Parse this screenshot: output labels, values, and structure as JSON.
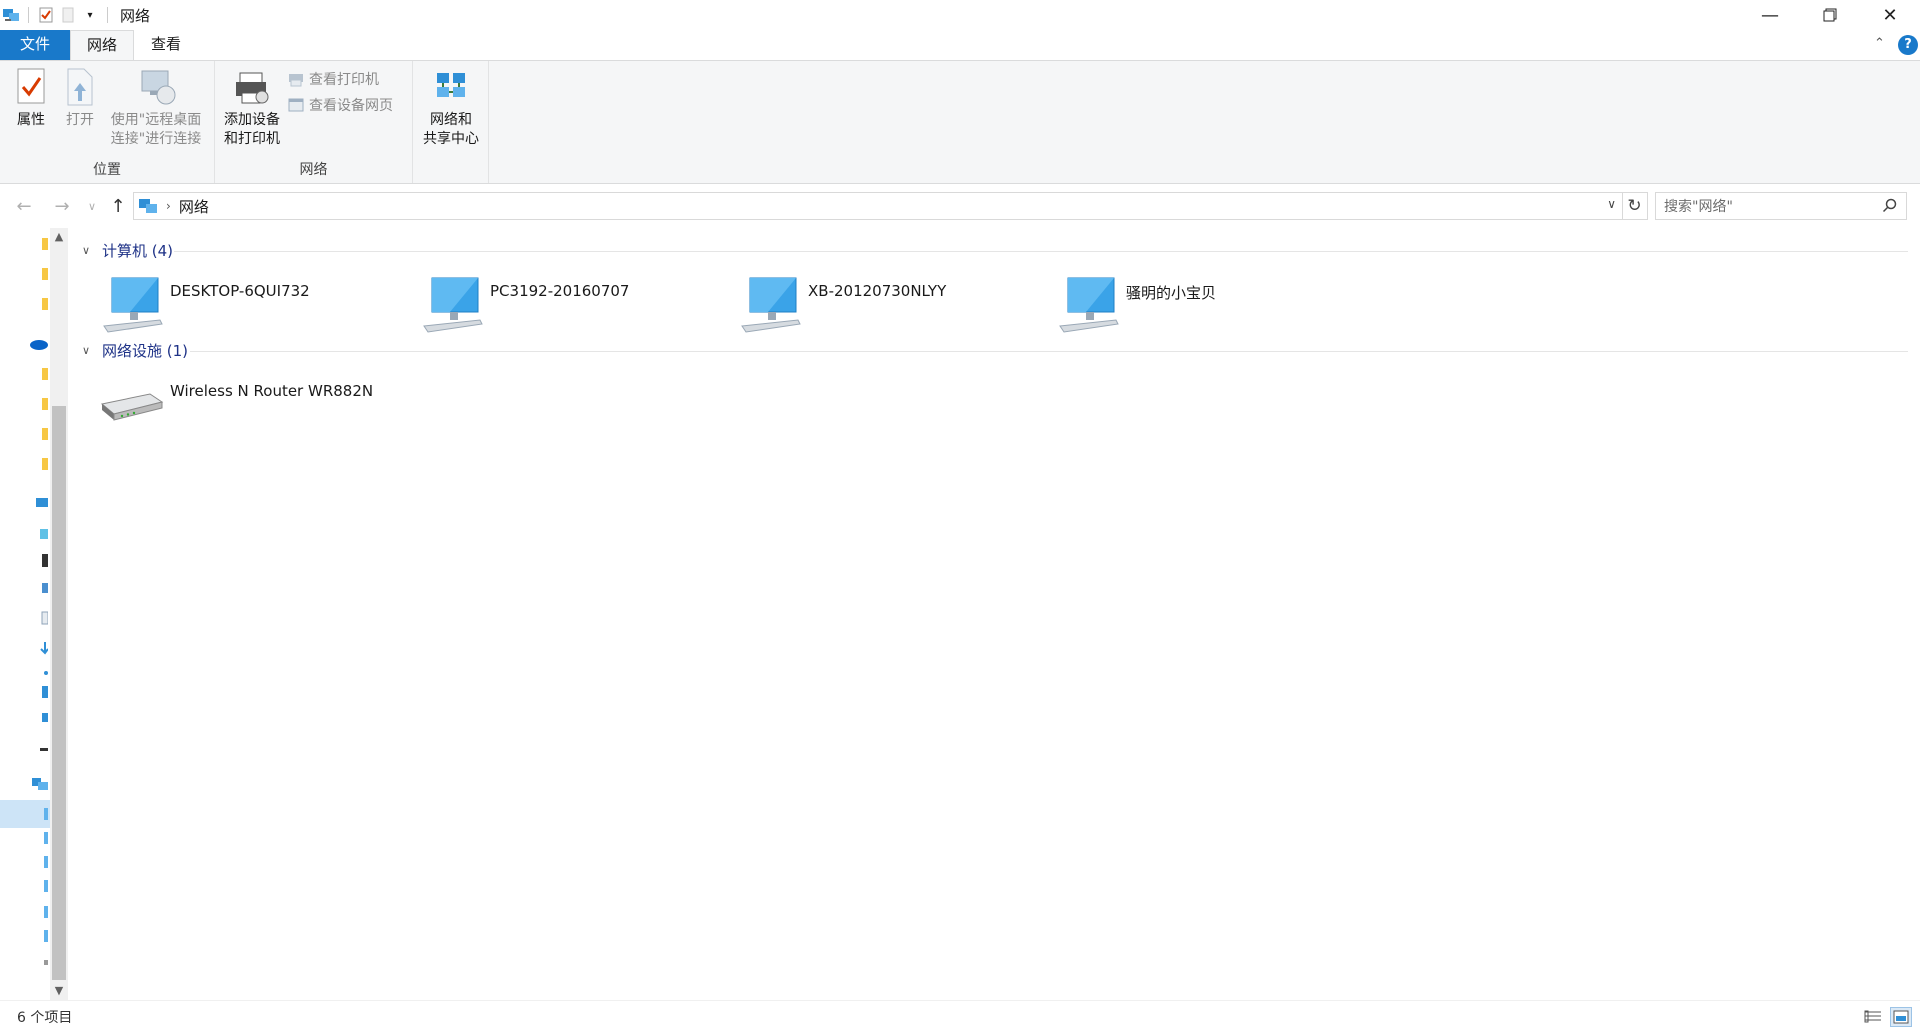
{
  "window": {
    "title": "网络"
  },
  "ribbon_tabs": {
    "file": "文件",
    "network": "网络",
    "view": "查看",
    "help": "?"
  },
  "ribbon": {
    "location_group": {
      "label": "位置",
      "properties": "属性",
      "open": "打开",
      "rdp_line1": "使用\"远程桌面",
      "rdp_line2": "连接\"进行连接"
    },
    "network_group": {
      "label": "网络",
      "add_device_line1": "添加设备",
      "add_device_line2": "和打印机",
      "view_printers": "查看打印机",
      "view_device_webpage": "查看设备网页"
    },
    "sharing_center_line1": "网络和",
    "sharing_center_line2": "共享中心"
  },
  "address_bar": {
    "breadcrumb": "网络",
    "search_placeholder": "搜索\"网络\""
  },
  "groups": [
    {
      "header": "计算机 (4)",
      "items": [
        "DESKTOP-6QUI732",
        "PC3192-20160707",
        "XB-20120730NLYY",
        "骚明的小宝贝"
      ]
    },
    {
      "header": "网络设施 (1)",
      "items": [
        "Wireless N Router WR882N"
      ]
    }
  ],
  "status": {
    "item_count": "6 个项目"
  }
}
